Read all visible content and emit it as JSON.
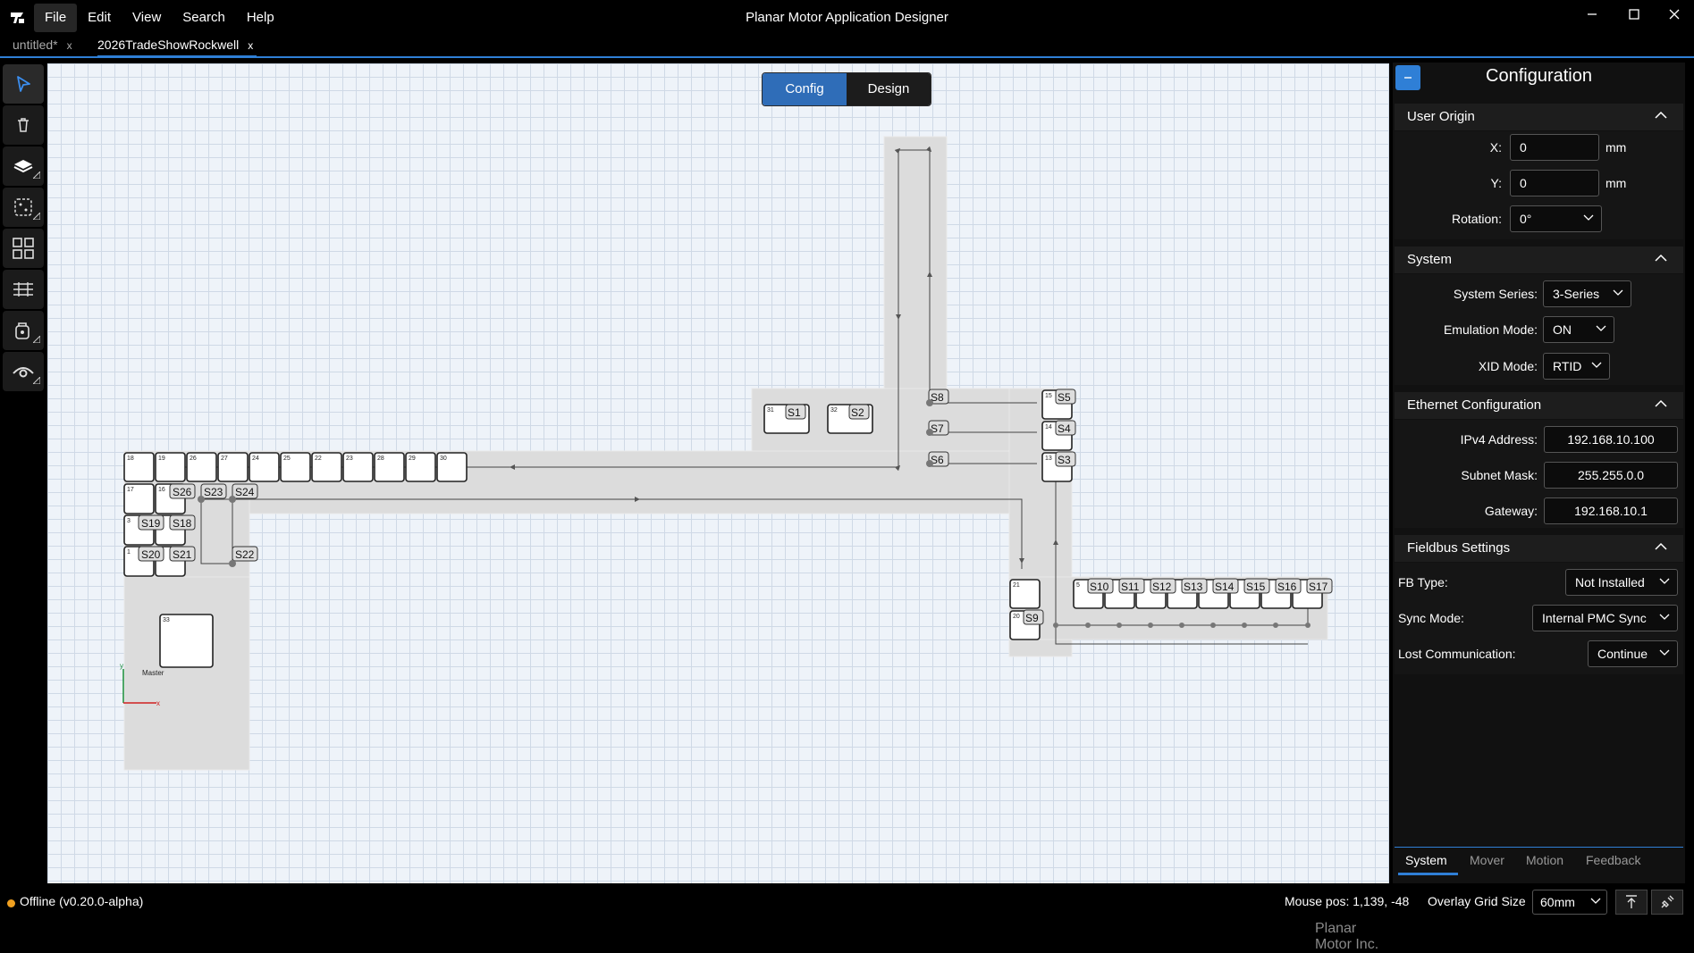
{
  "app": {
    "window_title": "Planar Motor Application Designer",
    "menu": [
      "File",
      "Edit",
      "View",
      "Search",
      "Help"
    ]
  },
  "tabs": [
    {
      "label": "untitled*",
      "close": "x"
    },
    {
      "label": "2026TradeShowRockwell",
      "close": "x"
    }
  ],
  "toolbar": {
    "tools": [
      "select-icon",
      "trash-icon",
      "layers-icon",
      "snap-icon",
      "grid-icon",
      "align-icon",
      "mover-icon",
      "view-icon"
    ]
  },
  "canvas": {
    "mode_toggle": {
      "config": "Config",
      "design": "Design",
      "active": "Config"
    },
    "watermark": "Planar Motor Inc.",
    "origin": {
      "x_label": "x",
      "y_label": "y",
      "master_label": "Master"
    },
    "tile_numbers": {
      "top_row": [
        "18",
        "19",
        "26",
        "27",
        "24",
        "25",
        "22",
        "23",
        "28",
        "29",
        "30"
      ],
      "left_column": [
        "17",
        "16",
        "3",
        "1"
      ],
      "upper_pair": [
        "31",
        "32"
      ],
      "right_stack": [
        "15",
        "14",
        "13"
      ],
      "lower_left": [
        "21",
        "20"
      ],
      "bottom_row_first": "5",
      "master_tile": "33"
    },
    "stations": {
      "left": [
        "S26",
        "S23",
        "S24",
        "S19",
        "S18",
        "S20",
        "S21",
        "S22"
      ],
      "upper": [
        "S1",
        "S2"
      ],
      "right_column": [
        "S8",
        "S7",
        "S6"
      ],
      "right_stack": [
        "S5",
        "S4",
        "S3"
      ],
      "bottom_row": [
        "S10",
        "S11",
        "S12",
        "S13",
        "S14",
        "S15",
        "S16",
        "S17"
      ],
      "lower_left": "S9"
    },
    "colors": {
      "grid": "#cfd9e6",
      "track": "#dcdcdc",
      "background": "#eef3f9"
    }
  },
  "panel": {
    "title": "Configuration",
    "user_origin": {
      "heading": "User Origin",
      "x_label": "X:",
      "x_value": "0",
      "x_unit": "mm",
      "y_label": "Y:",
      "y_value": "0",
      "y_unit": "mm",
      "rotation_label": "Rotation:",
      "rotation_value": "0°"
    },
    "system": {
      "heading": "System",
      "series_label": "System Series:",
      "series_value": "3-Series",
      "emulation_label": "Emulation Mode:",
      "emulation_value": "ON",
      "xid_label": "XID Mode:",
      "xid_value": "RTID"
    },
    "ethernet": {
      "heading": "Ethernet Configuration",
      "ipv4_label": "IPv4 Address:",
      "ipv4_value": "192.168.10.100",
      "subnet_label": "Subnet Mask:",
      "subnet_value": "255.255.0.0",
      "gateway_label": "Gateway:",
      "gateway_value": "192.168.10.1"
    },
    "fieldbus": {
      "heading": "Fieldbus Settings",
      "fb_type_label": "FB Type:",
      "fb_type_value": "Not Installed",
      "sync_label": "Sync Mode:",
      "sync_value": "Internal PMC Sync",
      "lost_label": "Lost Communication:",
      "lost_value": "Continue"
    },
    "bottom_tabs": [
      "System",
      "Mover",
      "Motion",
      "Feedback"
    ],
    "accent_color": "#2f7fd6"
  },
  "status": {
    "connection": "Offline (v0.20.0-alpha)",
    "mouse_pos": "Mouse pos: 1,139, -48",
    "overlay_label": "Overlay Grid Size",
    "overlay_value": "60mm",
    "status_color": "#f0a020"
  }
}
